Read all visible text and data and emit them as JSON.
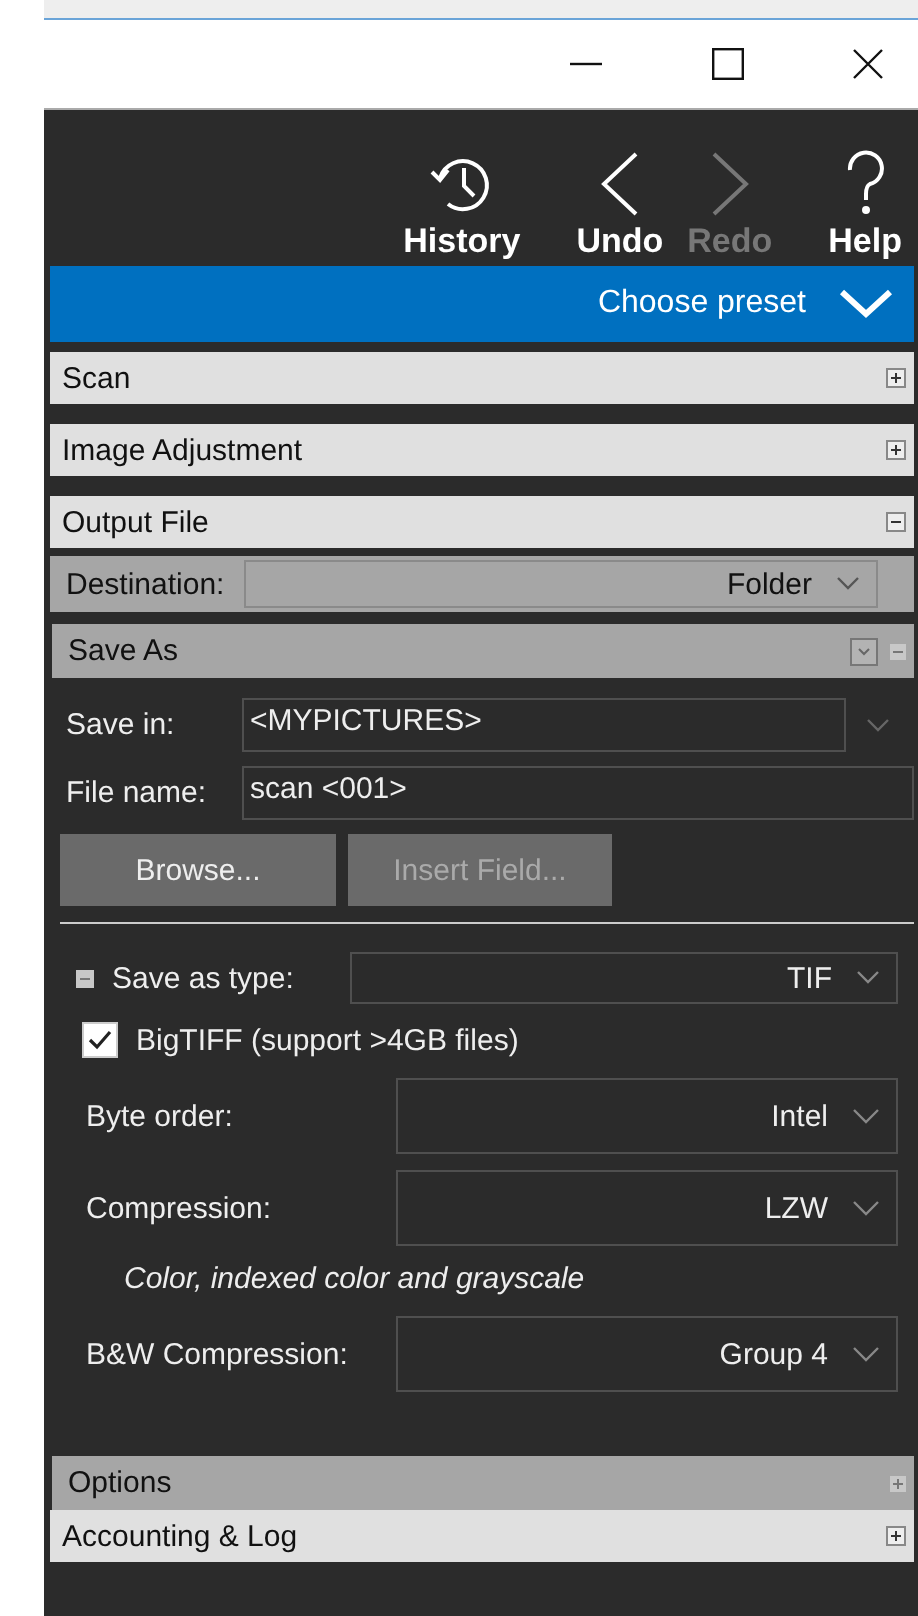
{
  "toolbar": [
    {
      "kind": "history",
      "label": "History",
      "disabled": false
    },
    {
      "kind": "undo",
      "label": "Undo",
      "disabled": false
    },
    {
      "kind": "redo",
      "label": "Redo",
      "disabled": true
    },
    {
      "kind": "help",
      "label": "Help",
      "disabled": false
    }
  ],
  "preset": {
    "label": "Choose preset"
  },
  "sections": [
    {
      "title": "Scan",
      "expanded": false
    },
    {
      "title": "Image Adjustment",
      "expanded": false
    },
    {
      "title": "Output File",
      "expanded": true,
      "destination": {
        "label": "Destination:",
        "value": "Folder"
      },
      "subsections": [
        {
          "title": "Save As",
          "expanded": true,
          "save_in": {
            "label": "Save in:",
            "value": "<MYPICTURES>"
          },
          "file_name": {
            "label": "File name:",
            "value": "scan <001>"
          },
          "buttons": [
            {
              "label": "Browse...",
              "disabled": false
            },
            {
              "label": "Insert Field...",
              "disabled": true
            }
          ],
          "save_as_type": {
            "label": "Save as type:",
            "value": "TIF",
            "expanded": true
          },
          "bigtiff": {
            "label": "BigTIFF (support >4GB files)",
            "checked": true
          },
          "fields": [
            {
              "label": "Byte order:",
              "value": "Intel"
            },
            {
              "label": "Compression:",
              "value": "LZW",
              "note": "Color, indexed color and grayscale"
            },
            {
              "label": "B&W Compression:",
              "value": "Group 4"
            }
          ]
        },
        {
          "title": "Options",
          "expanded": false
        }
      ]
    },
    {
      "title": "Accounting & Log",
      "expanded": false
    }
  ]
}
